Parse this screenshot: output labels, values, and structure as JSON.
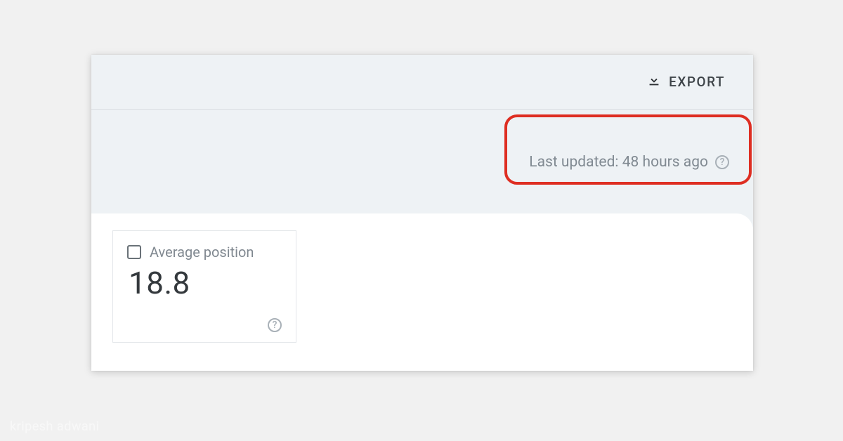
{
  "toolbar": {
    "export_label": "EXPORT"
  },
  "status": {
    "last_updated_text": "Last updated: 48 hours ago"
  },
  "metric": {
    "label": "Average position",
    "value": "18.8"
  },
  "watermark": "kripesh adwani"
}
